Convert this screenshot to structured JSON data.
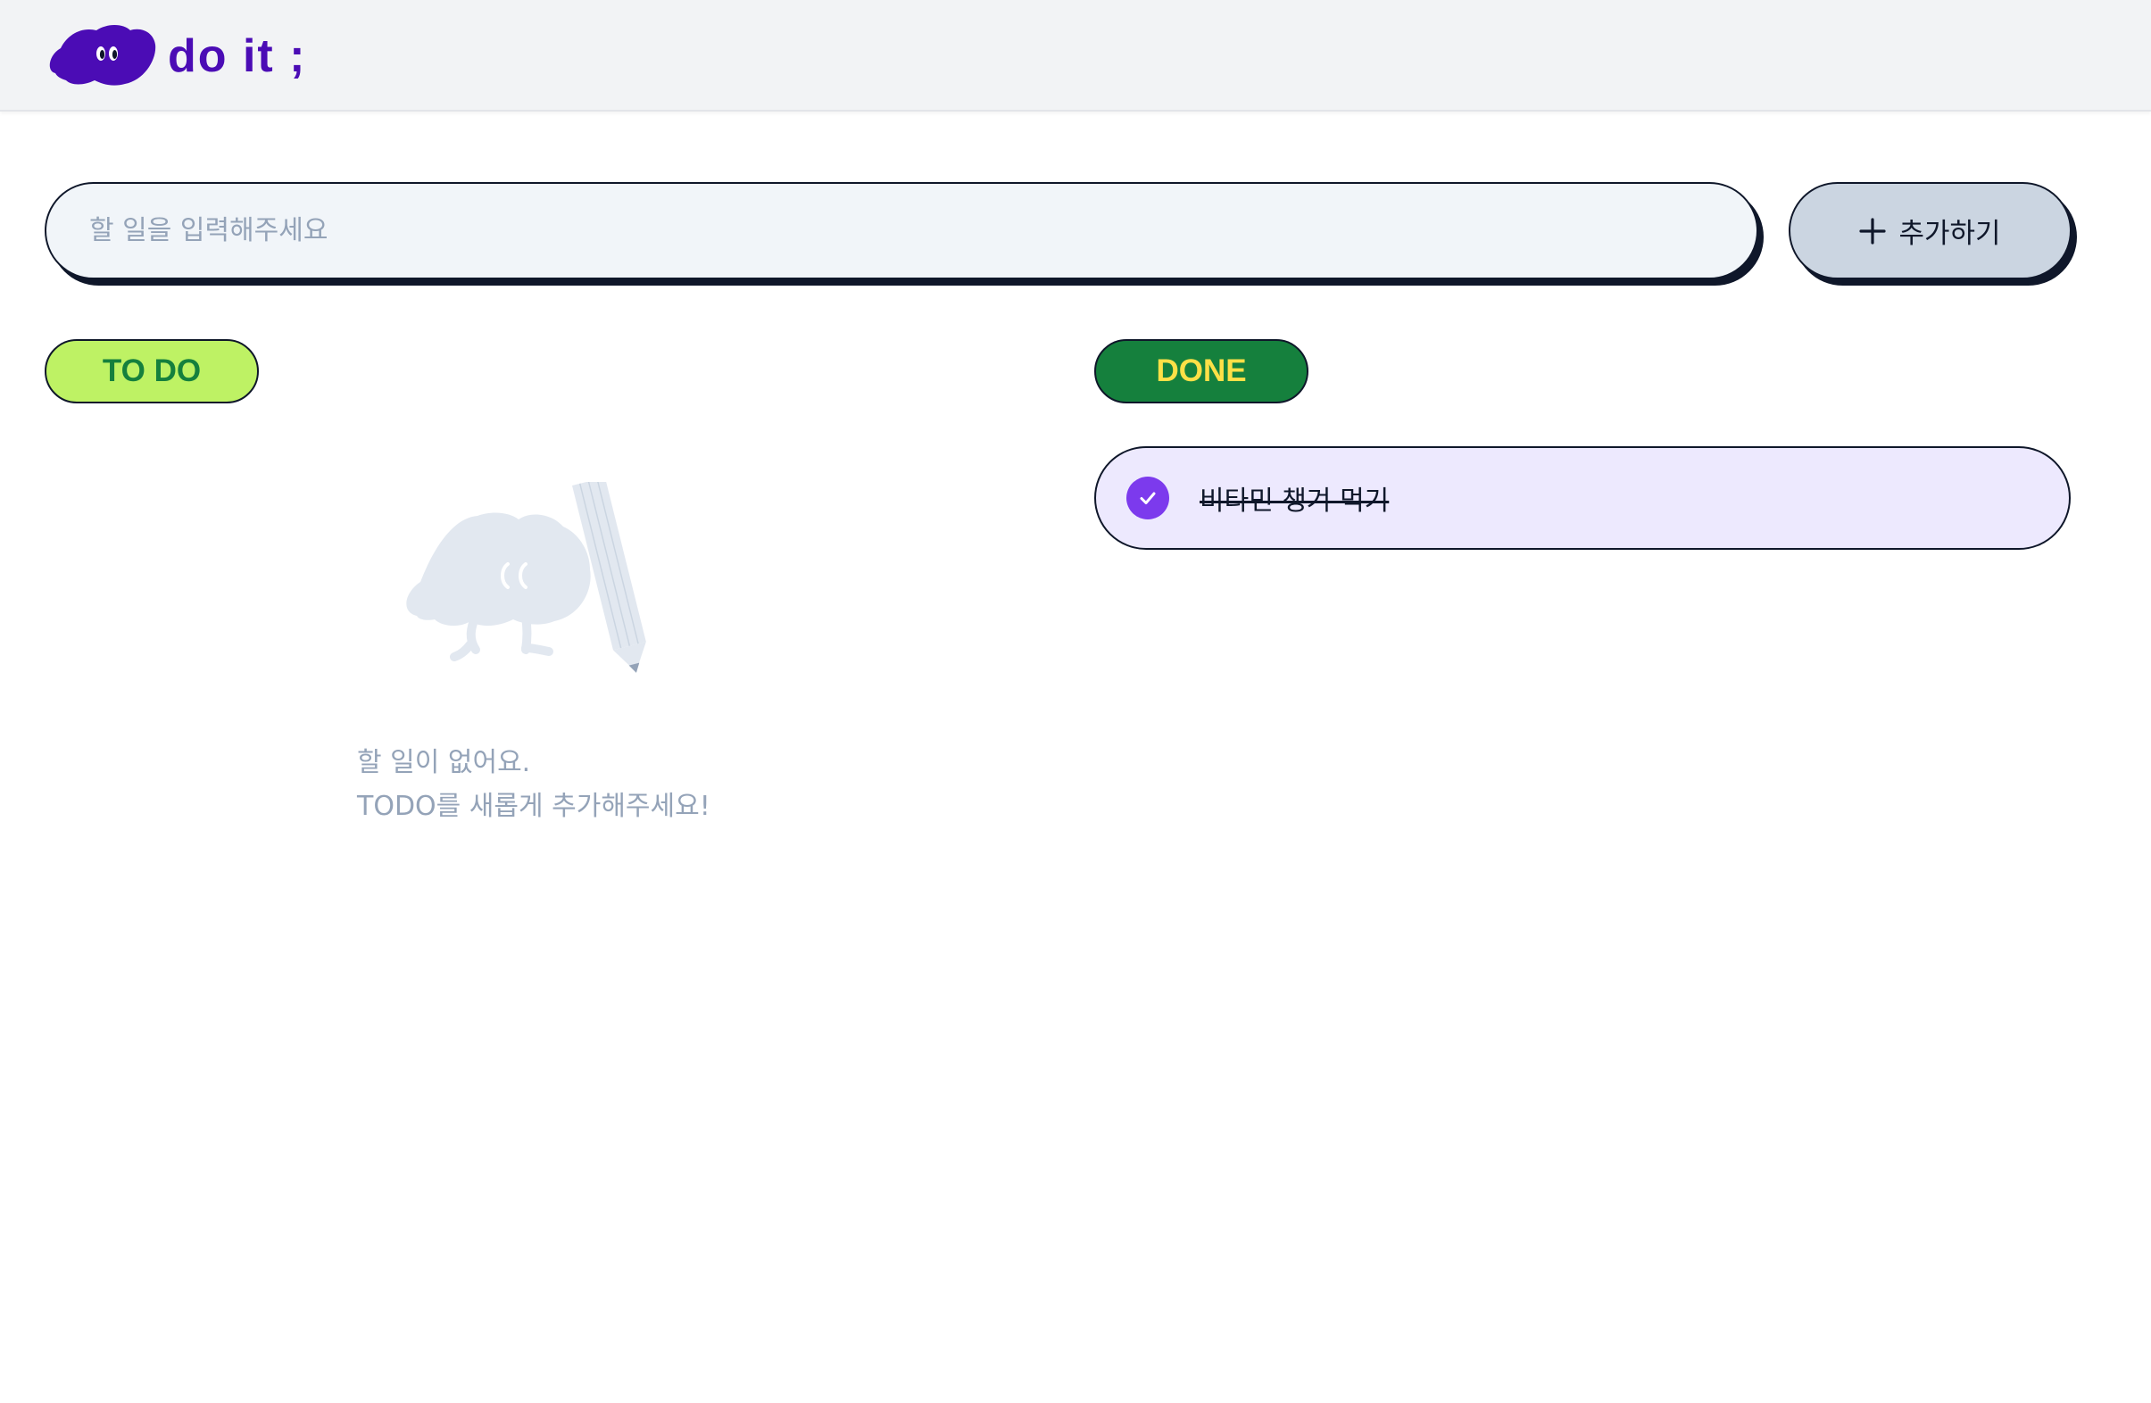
{
  "header": {
    "logo_text": "do it ;",
    "logo_color": "#4b0cb5"
  },
  "add_bar": {
    "input_value": "",
    "input_placeholder": "할 일을 입력해주세요",
    "add_button_label": "추가하기",
    "add_button_icon": "plus-icon"
  },
  "todo": {
    "title": "TO DO",
    "empty_message_line1": "할 일이 없어요.",
    "empty_message_line2": "TODO를 새롭게 추가해주세요!",
    "empty_icon": "empty-todo-illustration",
    "items": []
  },
  "done": {
    "title": "DONE",
    "items": [
      {
        "label": "비타민 챙겨 먹기",
        "done": true
      }
    ]
  },
  "colors": {
    "header_bg": "#f2f3f5",
    "todo_pill_bg": "#bef264",
    "todo_pill_text": "#15803d",
    "done_pill_bg": "#15803d",
    "done_pill_text": "#fde047",
    "done_item_bg": "#ede9fe",
    "check_color": "#7c3aed"
  }
}
